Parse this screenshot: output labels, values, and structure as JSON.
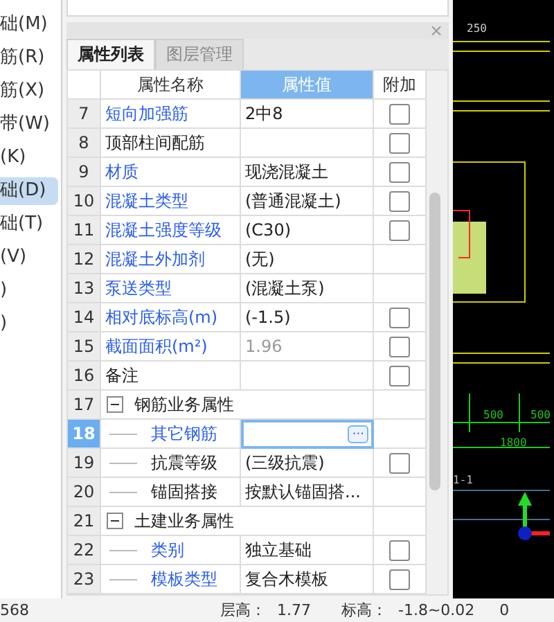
{
  "sidebar": {
    "items": [
      {
        "label": "础(M)",
        "selected": false
      },
      {
        "label": "筋(R)",
        "selected": false
      },
      {
        "label": "筋(X)",
        "selected": false
      },
      {
        "label": "带(W)",
        "selected": false
      },
      {
        "label": "(K)",
        "selected": false
      },
      {
        "label": "础(D)",
        "selected": true
      },
      {
        "label": "础(T)",
        "selected": false
      },
      {
        "label": "(V)",
        "selected": false
      },
      {
        "label": ")",
        "selected": false
      },
      {
        "label": ")",
        "selected": false
      }
    ]
  },
  "panel": {
    "close": "×",
    "tabs": [
      {
        "label": "属性列表",
        "selected": true
      },
      {
        "label": "图层管理",
        "selected": false
      }
    ],
    "columns": [
      {
        "label": "属性名称",
        "selected": false
      },
      {
        "label": "属性值",
        "selected": true
      },
      {
        "label": "附加",
        "selected": false
      }
    ],
    "rows": [
      {
        "kind": "prop",
        "num": "7",
        "name": "短向加强筋",
        "value": "2中8",
        "linked": true,
        "checkbox": true,
        "checked": false,
        "selected": false
      },
      {
        "kind": "prop",
        "num": "8",
        "name": "顶部柱间配筋",
        "value": "",
        "linked": false,
        "checkbox": true,
        "checked": false,
        "selected": false
      },
      {
        "kind": "prop",
        "num": "9",
        "name": "材质",
        "value": "现浇混凝土",
        "linked": true,
        "checkbox": true,
        "checked": false,
        "selected": false
      },
      {
        "kind": "prop",
        "num": "10",
        "name": "混凝土类型",
        "value": "(普通混凝土)",
        "linked": true,
        "checkbox": true,
        "checked": false,
        "selected": false
      },
      {
        "kind": "prop",
        "num": "11",
        "name": "混凝土强度等级",
        "value": "(C30)",
        "linked": true,
        "checkbox": true,
        "checked": false,
        "selected": false
      },
      {
        "kind": "prop",
        "num": "12",
        "name": "混凝土外加剂",
        "value": "(无)",
        "linked": true,
        "checkbox": false,
        "selected": false
      },
      {
        "kind": "prop",
        "num": "13",
        "name": "泵送类型",
        "value": "(混凝土泵)",
        "linked": true,
        "checkbox": false,
        "selected": false
      },
      {
        "kind": "prop",
        "num": "14",
        "name": "相对底标高(m)",
        "value": "(-1.5)",
        "linked": true,
        "checkbox": true,
        "checked": false,
        "selected": false
      },
      {
        "kind": "prop",
        "num": "15",
        "name": "截面面积(m²)",
        "value": "1.96",
        "linked": true,
        "disabled": true,
        "checkbox": true,
        "checked": false,
        "selected": false
      },
      {
        "kind": "prop",
        "num": "16",
        "name": "备注",
        "value": "",
        "linked": false,
        "checkbox": true,
        "checked": false,
        "selected": false
      },
      {
        "kind": "group",
        "num": "17",
        "name": "钢筋业务属性",
        "expanded": true,
        "selected": false
      },
      {
        "kind": "child",
        "num": "18",
        "name": "其它钢筋",
        "value": "",
        "linked": true,
        "editing": true,
        "more": "···",
        "checkbox": false,
        "selected": true
      },
      {
        "kind": "child",
        "num": "19",
        "name": "抗震等级",
        "value": "(三级抗震)",
        "linked": false,
        "checkbox": true,
        "checked": false,
        "selected": false
      },
      {
        "kind": "child",
        "num": "20",
        "name": "锚固搭接",
        "value": "按默认锚固搭...",
        "linked": false,
        "checkbox": false,
        "selected": false
      },
      {
        "kind": "group",
        "num": "21",
        "name": "土建业务属性",
        "expanded": true,
        "selected": false
      },
      {
        "kind": "child",
        "num": "22",
        "name": "类别",
        "value": "独立基础",
        "linked": true,
        "checkbox": true,
        "checked": false,
        "selected": false
      },
      {
        "kind": "child",
        "num": "23",
        "name": "模板类型",
        "value": "复合木模板",
        "linked": true,
        "checkbox": true,
        "checked": false,
        "selected": false
      }
    ]
  },
  "canvas": {
    "labels": [
      "250",
      "500",
      "500",
      "1800",
      "1-1"
    ]
  },
  "status_bar": [
    "568",
    "层高：",
    "1.77",
    "标高：",
    "-1.8~0.02",
    "0"
  ]
}
